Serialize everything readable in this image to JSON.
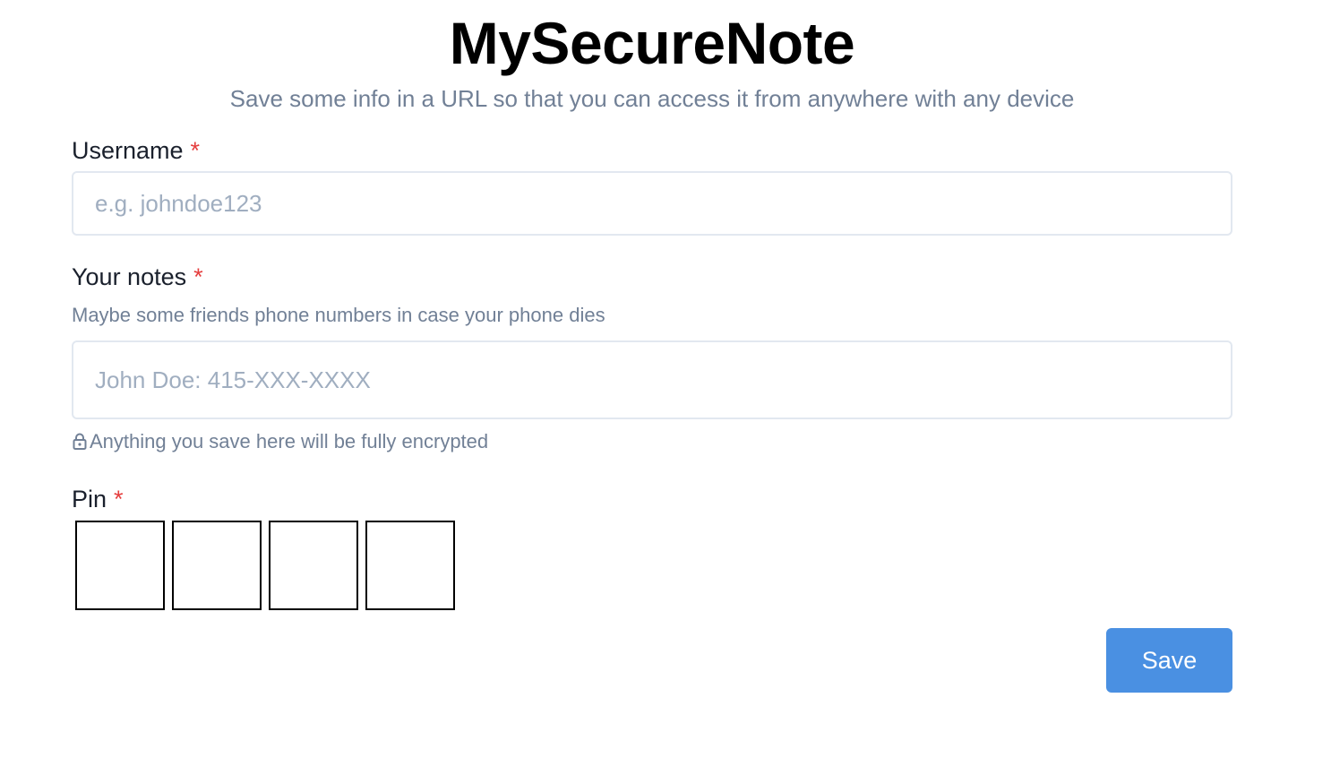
{
  "header": {
    "title": "MySecureNote",
    "subtitle": "Save some info in a URL so that you can access it from anywhere with any device"
  },
  "form": {
    "username": {
      "label": "Username",
      "required_mark": "*",
      "placeholder": "e.g. johndoe123",
      "value": ""
    },
    "notes": {
      "label": "Your notes",
      "required_mark": "*",
      "helper": "Maybe some friends phone numbers in case your phone dies",
      "placeholder": "John Doe: 415-XXX-XXXX",
      "value": "",
      "encryption_note": "Anything you save here will be fully encrypted",
      "encryption_icon": "lock-icon"
    },
    "pin": {
      "label": "Pin",
      "required_mark": "*",
      "digits": [
        "",
        "",
        "",
        ""
      ]
    },
    "save_label": "Save"
  },
  "colors": {
    "accent": "#4a90e2",
    "required": "#e53e3e",
    "muted_text": "#718096",
    "placeholder": "#a0aec0",
    "input_border": "#e2e8f0"
  }
}
